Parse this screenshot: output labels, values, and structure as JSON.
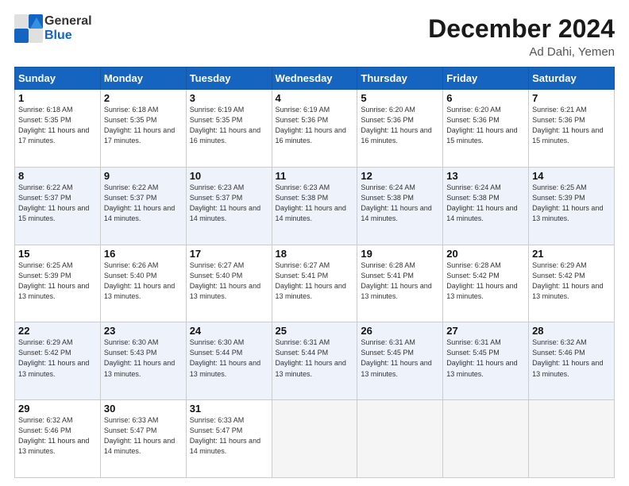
{
  "header": {
    "logo_general": "General",
    "logo_blue": "Blue",
    "month": "December 2024",
    "location": "Ad Dahi, Yemen"
  },
  "days_of_week": [
    "Sunday",
    "Monday",
    "Tuesday",
    "Wednesday",
    "Thursday",
    "Friday",
    "Saturday"
  ],
  "weeks": [
    [
      {
        "day": 1,
        "sunrise": "6:18 AM",
        "sunset": "5:35 PM",
        "daylight": "11 hours and 17 minutes."
      },
      {
        "day": 2,
        "sunrise": "6:18 AM",
        "sunset": "5:35 PM",
        "daylight": "11 hours and 17 minutes."
      },
      {
        "day": 3,
        "sunrise": "6:19 AM",
        "sunset": "5:35 PM",
        "daylight": "11 hours and 16 minutes."
      },
      {
        "day": 4,
        "sunrise": "6:19 AM",
        "sunset": "5:36 PM",
        "daylight": "11 hours and 16 minutes."
      },
      {
        "day": 5,
        "sunrise": "6:20 AM",
        "sunset": "5:36 PM",
        "daylight": "11 hours and 16 minutes."
      },
      {
        "day": 6,
        "sunrise": "6:20 AM",
        "sunset": "5:36 PM",
        "daylight": "11 hours and 15 minutes."
      },
      {
        "day": 7,
        "sunrise": "6:21 AM",
        "sunset": "5:36 PM",
        "daylight": "11 hours and 15 minutes."
      }
    ],
    [
      {
        "day": 8,
        "sunrise": "6:22 AM",
        "sunset": "5:37 PM",
        "daylight": "11 hours and 15 minutes."
      },
      {
        "day": 9,
        "sunrise": "6:22 AM",
        "sunset": "5:37 PM",
        "daylight": "11 hours and 14 minutes."
      },
      {
        "day": 10,
        "sunrise": "6:23 AM",
        "sunset": "5:37 PM",
        "daylight": "11 hours and 14 minutes."
      },
      {
        "day": 11,
        "sunrise": "6:23 AM",
        "sunset": "5:38 PM",
        "daylight": "11 hours and 14 minutes."
      },
      {
        "day": 12,
        "sunrise": "6:24 AM",
        "sunset": "5:38 PM",
        "daylight": "11 hours and 14 minutes."
      },
      {
        "day": 13,
        "sunrise": "6:24 AM",
        "sunset": "5:38 PM",
        "daylight": "11 hours and 14 minutes."
      },
      {
        "day": 14,
        "sunrise": "6:25 AM",
        "sunset": "5:39 PM",
        "daylight": "11 hours and 13 minutes."
      }
    ],
    [
      {
        "day": 15,
        "sunrise": "6:25 AM",
        "sunset": "5:39 PM",
        "daylight": "11 hours and 13 minutes."
      },
      {
        "day": 16,
        "sunrise": "6:26 AM",
        "sunset": "5:40 PM",
        "daylight": "11 hours and 13 minutes."
      },
      {
        "day": 17,
        "sunrise": "6:27 AM",
        "sunset": "5:40 PM",
        "daylight": "11 hours and 13 minutes."
      },
      {
        "day": 18,
        "sunrise": "6:27 AM",
        "sunset": "5:41 PM",
        "daylight": "11 hours and 13 minutes."
      },
      {
        "day": 19,
        "sunrise": "6:28 AM",
        "sunset": "5:41 PM",
        "daylight": "11 hours and 13 minutes."
      },
      {
        "day": 20,
        "sunrise": "6:28 AM",
        "sunset": "5:42 PM",
        "daylight": "11 hours and 13 minutes."
      },
      {
        "day": 21,
        "sunrise": "6:29 AM",
        "sunset": "5:42 PM",
        "daylight": "11 hours and 13 minutes."
      }
    ],
    [
      {
        "day": 22,
        "sunrise": "6:29 AM",
        "sunset": "5:42 PM",
        "daylight": "11 hours and 13 minutes."
      },
      {
        "day": 23,
        "sunrise": "6:30 AM",
        "sunset": "5:43 PM",
        "daylight": "11 hours and 13 minutes."
      },
      {
        "day": 24,
        "sunrise": "6:30 AM",
        "sunset": "5:44 PM",
        "daylight": "11 hours and 13 minutes."
      },
      {
        "day": 25,
        "sunrise": "6:31 AM",
        "sunset": "5:44 PM",
        "daylight": "11 hours and 13 minutes."
      },
      {
        "day": 26,
        "sunrise": "6:31 AM",
        "sunset": "5:45 PM",
        "daylight": "11 hours and 13 minutes."
      },
      {
        "day": 27,
        "sunrise": "6:31 AM",
        "sunset": "5:45 PM",
        "daylight": "11 hours and 13 minutes."
      },
      {
        "day": 28,
        "sunrise": "6:32 AM",
        "sunset": "5:46 PM",
        "daylight": "11 hours and 13 minutes."
      }
    ],
    [
      {
        "day": 29,
        "sunrise": "6:32 AM",
        "sunset": "5:46 PM",
        "daylight": "11 hours and 13 minutes."
      },
      {
        "day": 30,
        "sunrise": "6:33 AM",
        "sunset": "5:47 PM",
        "daylight": "11 hours and 14 minutes."
      },
      {
        "day": 31,
        "sunrise": "6:33 AM",
        "sunset": "5:47 PM",
        "daylight": "11 hours and 14 minutes."
      },
      null,
      null,
      null,
      null
    ]
  ],
  "labels": {
    "sunrise": "Sunrise:",
    "sunset": "Sunset:",
    "daylight": "Daylight:"
  }
}
